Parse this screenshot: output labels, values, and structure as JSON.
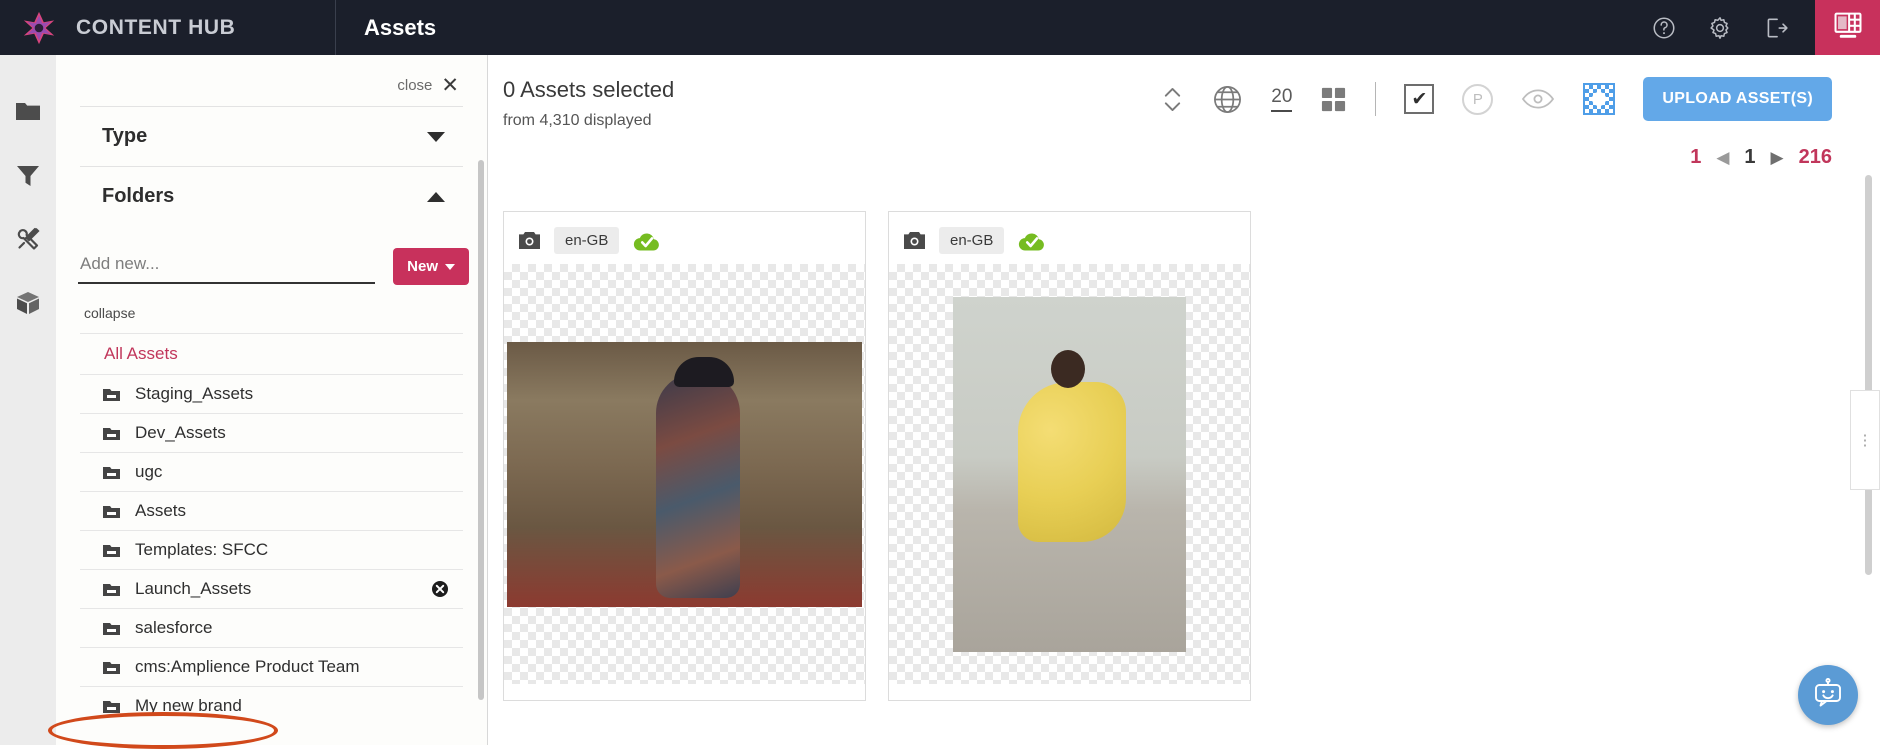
{
  "topbar": {
    "brand_name": "CONTENT HUB",
    "logo_icon": "amplience-star-logo",
    "page_title": "Assets",
    "icons": [
      {
        "name": "help-icon",
        "label": "Help"
      },
      {
        "name": "gear-icon",
        "label": "Settings"
      },
      {
        "name": "logout-icon",
        "label": "Log out"
      }
    ],
    "panel_toggle_icon": "layout-panel-icon",
    "accent_pink": "#c8315c",
    "bar_bg": "#1b1f2b"
  },
  "rail": {
    "items": [
      {
        "name": "folder-icon",
        "label": "Folders"
      },
      {
        "name": "filter-icon",
        "label": "Filters"
      },
      {
        "name": "tools-icon",
        "label": "Tools"
      },
      {
        "name": "cube-icon",
        "label": "Assets"
      }
    ]
  },
  "panel": {
    "close_label": "close",
    "close_icon": "close-icon",
    "sections": [
      {
        "title": "Type",
        "expanded": false
      },
      {
        "title": "Folders",
        "expanded": true
      }
    ],
    "add_input_placeholder": "Add new...",
    "add_input_value": "",
    "new_button_label": "New",
    "collapse_label": "collapse",
    "all_assets_label": "All Assets",
    "folders": [
      {
        "label": "Staging_Assets",
        "deletable": false
      },
      {
        "label": "Dev_Assets",
        "deletable": false
      },
      {
        "label": "ugc",
        "deletable": false
      },
      {
        "label": "Assets",
        "deletable": false
      },
      {
        "label": "Templates: SFCC",
        "deletable": false
      },
      {
        "label": "Launch_Assets",
        "deletable": true
      },
      {
        "label": "salesforce",
        "deletable": false
      },
      {
        "label": "cms:Amplience Product Team",
        "deletable": false
      },
      {
        "label": "My new brand",
        "deletable": false,
        "annotated": true
      }
    ],
    "annotation_color": "#d1491b"
  },
  "main": {
    "selected_title": "0 Assets selected",
    "selected_sub": "from 4,310 displayed",
    "tools": [
      {
        "name": "sort-order-icon",
        "label": "Sort order"
      },
      {
        "name": "globe-icon",
        "label": "Locale"
      },
      {
        "name": "page-size-selector",
        "label": "20"
      },
      {
        "name": "grid-view-icon",
        "label": "Grid view"
      },
      {
        "name": "select-all-checkbox",
        "label": "Select all"
      },
      {
        "name": "publish-status-icon",
        "label": "P"
      },
      {
        "name": "eye-icon",
        "label": "Preview"
      },
      {
        "name": "transparency-icon",
        "label": "Transparency"
      }
    ],
    "upload_button_label": "UPLOAD ASSET(S)",
    "upload_button_color": "#63a8e8",
    "pagination": {
      "first_page": "1",
      "prev_icon": "chevron-left-icon",
      "current_page": "1",
      "next_icon": "chevron-right-icon",
      "last_page": "216"
    },
    "cards": [
      {
        "type_icon": "camera-icon",
        "locale": "en-GB",
        "status_icon": "cloud-published-icon",
        "thumbnail": "woman-in-striped-dress-with-hat"
      },
      {
        "type_icon": "camera-icon",
        "locale": "en-GB",
        "status_icon": "cloud-published-icon",
        "thumbnail": "woman-in-yellow-polka-dot-dress"
      }
    ],
    "drawer_handle_icon": "drawer-handle-icon",
    "chatbot_icon": "chatbot-icon"
  }
}
